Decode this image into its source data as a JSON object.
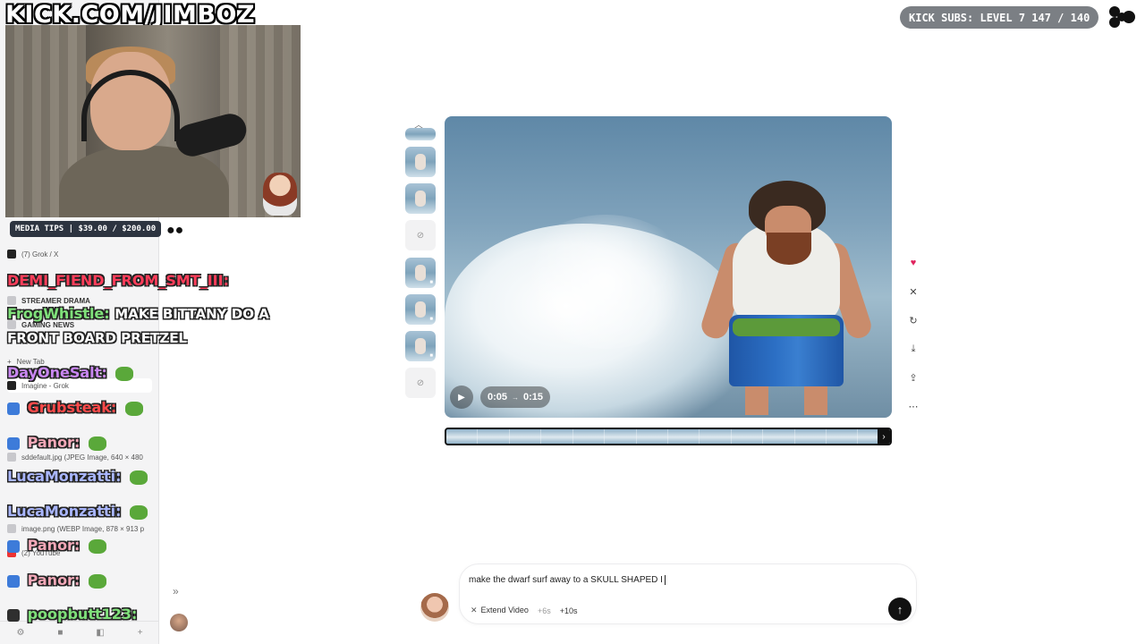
{
  "stream": {
    "channel_url": "KICK.COM/JIMBOZ",
    "media_tips": "MEDIA TIPS | $39.00 / $200.00",
    "kick_subs": "KICK SUBS: LEVEL 7 147 / 140"
  },
  "chat": [
    {
      "user": "DEMI_FIEND_FROM_SMT_III:",
      "user_color": "#ff3d5a",
      "message": ""
    },
    {
      "user": "FrogWhistle:",
      "user_color": "#7fe07a",
      "message": "MAKE BITTANY DO A"
    },
    {
      "user": "",
      "user_color": "#ffffff",
      "message": "FRONT BOARD PRETZEL"
    },
    {
      "user": "DayOneSalt:",
      "user_color": "#c987f2",
      "message": ""
    },
    {
      "user": "Grubsteak:",
      "user_color": "#ff4a4a",
      "message": ""
    },
    {
      "user": "Panor:",
      "user_color": "#f2a8b8",
      "message": ""
    },
    {
      "user": "LucaMonzatti:",
      "user_color": "#a9b6ff",
      "message": ""
    },
    {
      "user": "LucaMonzatti:",
      "user_color": "#a9b6ff",
      "message": ""
    },
    {
      "user": "Panor:",
      "user_color": "#f2a8b8",
      "message": ""
    },
    {
      "user": "Panor:",
      "user_color": "#f2a8b8",
      "message": ""
    },
    {
      "user": "poopbutt123:",
      "user_color": "#7fe07a",
      "message": ""
    }
  ],
  "sidebar": {
    "items": [
      {
        "label": "(7) Grok / X",
        "type": "tab"
      },
      {
        "label": "STREAMER DRAMA",
        "type": "folder"
      },
      {
        "label": "GAMING NEWS",
        "type": "folder"
      },
      {
        "label": "New Tab",
        "type": "new"
      },
      {
        "label": "Imagine - Grok",
        "type": "tab-active"
      },
      {
        "label": "sddefault.jpg (JPEG Image, 640 × 480",
        "type": "tab"
      },
      {
        "label": "image.png (WEBP Image, 878 × 913 p",
        "type": "tab"
      },
      {
        "label": "(2) YouTube",
        "type": "tab-red"
      }
    ]
  },
  "video": {
    "time_current": "0:05",
    "time_total": "0:15"
  },
  "prompt": {
    "text": "make the dwarf surf away to a SKULL SHAPED I",
    "chip_extend": "Extend Video",
    "chip_6s": "+6s",
    "chip_10s": "+10s"
  }
}
